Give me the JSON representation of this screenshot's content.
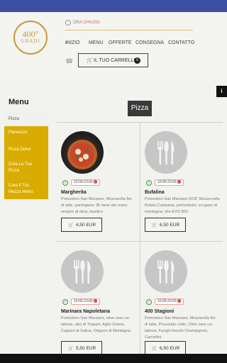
{
  "header": {
    "logo": {
      "line1": "400°",
      "line2": "GRADI"
    },
    "hours": {
      "prefix": "ORA",
      "status": "CHIUSO"
    },
    "nav": {
      "inizio": "INIZIO",
      "caret": "▾",
      "menu": "MENU",
      "offerte": "OFFERTE",
      "consegna": "CONSEGNA",
      "contatto": "CONTATTO"
    },
    "cart": {
      "label": "IL TUO CARRELLO",
      "count": "0"
    }
  },
  "info_tab": "i",
  "sidebar": {
    "title": "Menu",
    "items": [
      {
        "label": "Pizza",
        "active": true
      },
      {
        "label": "Panuozzo"
      },
      {
        "label": "Pizza Dolce"
      },
      {
        "label": "Crea La Tua Pizza"
      },
      {
        "label": "Crea Il Tuo Mezzo Metro"
      }
    ]
  },
  "section_title": "Pizza",
  "products": [
    {
      "name": "Margherita",
      "time": "10:00-23:00",
      "description": "Pomodoro San Marzano, Mozzarella fior di latte, parmigiano 36 mesi olio extra-vergine di oliva, basilico",
      "price": "4,50 EUR",
      "image": "photo"
    },
    {
      "name": "Bufalina",
      "time": "10:00-23:00",
      "description": "Pomodoro San Marzano DOP, Mozza-rella Bufala Campana, pomodorini, ori-gano di montagna, olio EVO BIO",
      "price": "6,50 EUR",
      "image": "placeholder"
    },
    {
      "name": "Marinara Napoletana",
      "time": "10:00-23:00",
      "description": "Pomodoro San Marzano, olive nere ca-labresi, alici di Trapani, Aglio Orsino, Capperi di Salina, Origano di Montagna",
      "price": "5,50 EUR",
      "image": "placeholder"
    },
    {
      "name": "400 Stagioni",
      "time": "10:00-23:00",
      "description": "Pomodoro San Marzano, Mozzarella fior di latte, Prosciutto cotto, Olive nere ca-labresi, Funghi freschi Champignon, Carciofini.",
      "price": "6,50 EUR",
      "image": "placeholder"
    }
  ],
  "icons": {
    "clock": "clock-icon",
    "phone": "phone-icon",
    "cart": "cart-icon",
    "cutlery": "cutlery-icon",
    "check": "check-circle-icon",
    "closed": "closed-x-icon"
  },
  "colors": {
    "top_bar": "#3c4fa3",
    "gold": "#c89a3c",
    "sidebar_gold": "#d8ac00",
    "status_closed": "#e06060"
  }
}
